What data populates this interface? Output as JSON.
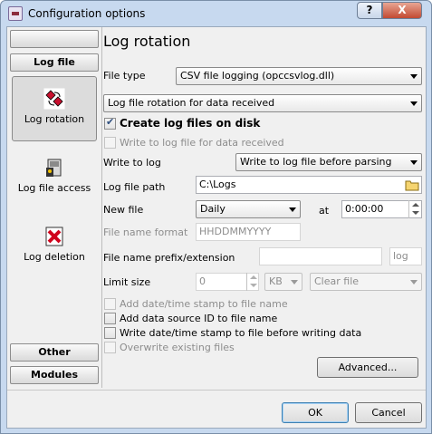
{
  "window": {
    "title": "Configuration options",
    "help_glyph": "?",
    "close_glyph": "X"
  },
  "sidebar": {
    "top_group": "",
    "log_file_group": "Log file",
    "items": [
      {
        "label": "Log rotation",
        "icon": "log-rotation-icon",
        "selected": true
      },
      {
        "label": "Log file access",
        "icon": "log-file-access-icon",
        "selected": false
      },
      {
        "label": "Log deletion",
        "icon": "log-deletion-icon",
        "selected": false
      }
    ],
    "other_group": "Other",
    "modules_group": "Modules"
  },
  "main": {
    "heading": "Log rotation",
    "file_type_label": "File type",
    "file_type_value": "CSV file logging (opccsvlog.dll)",
    "rotation_mode_value": "Log file rotation for data received",
    "create_log_files_label": "Create log files on disk",
    "create_log_files_checked": true,
    "write_for_data_received_label": "Write to log file for data received",
    "write_to_log_label": "Write to log",
    "write_to_log_value": "Write to log file before parsing",
    "log_file_path_label": "Log file path",
    "log_file_path_value": "C:\\Logs",
    "new_file_label": "New file",
    "new_file_value": "Daily",
    "at_label": "at",
    "at_value": "0:00:00",
    "file_name_format_label": "File name format",
    "file_name_format_placeholder": "HHDDMMYYYY",
    "prefix_extension_label": "File name prefix/extension",
    "prefix_value": "",
    "extension_value": "log",
    "limit_size_label": "Limit size",
    "limit_size_value": "0",
    "limit_unit_value": "KB",
    "limit_action_value": "Clear file",
    "options": [
      {
        "label": "Add date/time stamp to file name",
        "checked": false,
        "disabled": true
      },
      {
        "label": "Add data source ID to file name",
        "checked": false,
        "disabled": false
      },
      {
        "label": "Write date/time stamp to file before writing data",
        "checked": false,
        "disabled": false
      },
      {
        "label": "Overwrite existing files",
        "checked": false,
        "disabled": true
      }
    ],
    "advanced_label": "Advanced..."
  },
  "footer": {
    "ok_label": "OK",
    "cancel_label": "Cancel"
  }
}
